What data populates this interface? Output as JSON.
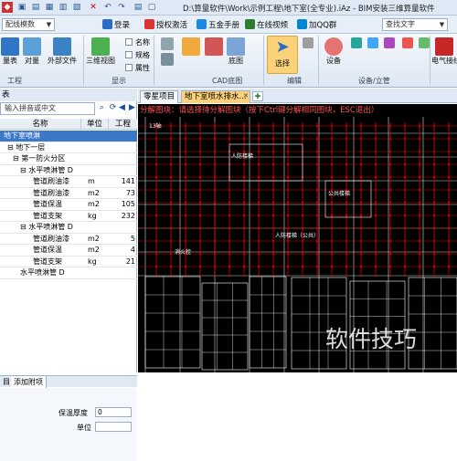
{
  "window": {
    "title": "D:\\算量软件\\Work\\示例工程\\地下室(全专业).iAz - BIM安装三维算量软件"
  },
  "menubar": {
    "layer_select": "配线模数",
    "items": [
      "登录",
      "授权激活",
      "五金手册",
      "在线视频",
      "加QQ群"
    ],
    "search_placeholder": "查找文字"
  },
  "ribbon": {
    "buttons": [
      "量表",
      "对量",
      "外部文件",
      "三维视图",
      "CAD底图",
      "底图",
      "检查",
      "选择",
      "设备",
      "电气接线"
    ],
    "checks": [
      "名称",
      "规格",
      "属性"
    ],
    "groups": [
      "工程",
      "显示",
      "CAD底图",
      "编辑",
      "设备/立管"
    ]
  },
  "left": {
    "header": "表",
    "search_placeholder": "输入拼音或中文",
    "columns": [
      "名称",
      "单位",
      "工程"
    ],
    "rows": [
      {
        "name": "地下室喷淋",
        "unit": "",
        "qty": ""
      },
      {
        "name": "地下一层",
        "unit": "",
        "qty": ""
      },
      {
        "name": "第一防火分区",
        "unit": "",
        "qty": ""
      },
      {
        "name": "水平喷淋管 D",
        "unit": "",
        "qty": ""
      },
      {
        "name": "管道刷油漆",
        "unit": "m",
        "qty": "141"
      },
      {
        "name": "管道刷油漆",
        "unit": "m2",
        "qty": "73"
      },
      {
        "name": "管道保温",
        "unit": "m2",
        "qty": "105"
      },
      {
        "name": "管道支架",
        "unit": "kg",
        "qty": "232"
      },
      {
        "name": "水平喷淋管 D",
        "unit": "",
        "qty": ""
      },
      {
        "name": "管道刷油漆",
        "unit": "m2",
        "qty": "5"
      },
      {
        "name": "管道保温",
        "unit": "m2",
        "qty": "4"
      },
      {
        "name": "管道支架",
        "unit": "kg",
        "qty": "21"
      },
      {
        "name": "水平喷淋管 D",
        "unit": "",
        "qty": ""
      }
    ],
    "panel_tabs": [
      "目",
      "添加附项"
    ],
    "fields": {
      "thickness_label": "保温厚度",
      "thickness_value": "0",
      "unit_label": "单位",
      "unit_value": ""
    }
  },
  "doc": {
    "tabs": [
      "零星项目",
      "地下室喷水排水..."
    ],
    "hint": "分解图块：请选择待分解图块（按下Ctrl键分解相同图块，ESC退出）"
  },
  "canvas": {
    "labels": [
      "13轴",
      "人防楼梯",
      "公共楼梯",
      "人防楼梯（公共）",
      "消火栓"
    ]
  },
  "watermark": "软件技巧",
  "colors": {
    "accent": "#3c78c8",
    "hint": "#ff5050",
    "cad_red": "#e00000",
    "cad_white": "#ffffff"
  }
}
